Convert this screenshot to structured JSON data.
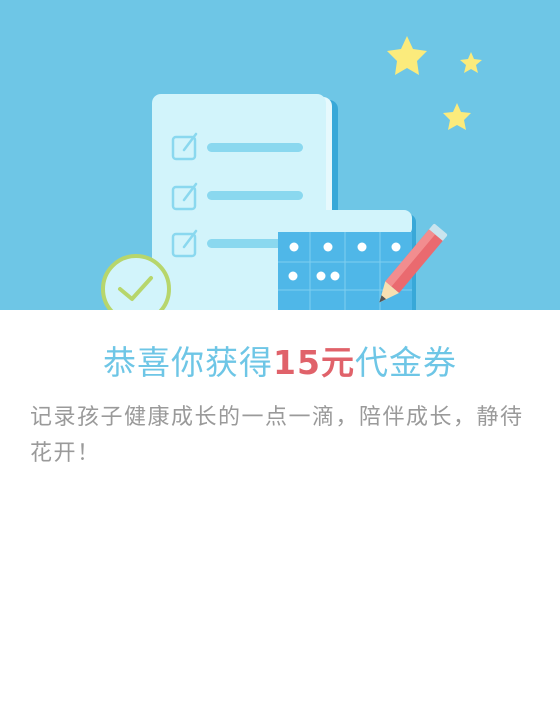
{
  "banner": {
    "background_color": "#6ec6e6",
    "illustration": [
      "checklist-document-icon",
      "calendar-icon",
      "pencil-icon",
      "checkmark-circle-icon",
      "star-icon"
    ]
  },
  "reward": {
    "title_prefix": "恭喜你获得",
    "amount": "15元",
    "title_suffix": "代金券",
    "title_color": "#6ec6e6",
    "amount_color": "#e0626a"
  },
  "description": "记录孩子健康成长的一点一滴，陪伴成长，静待花开！"
}
